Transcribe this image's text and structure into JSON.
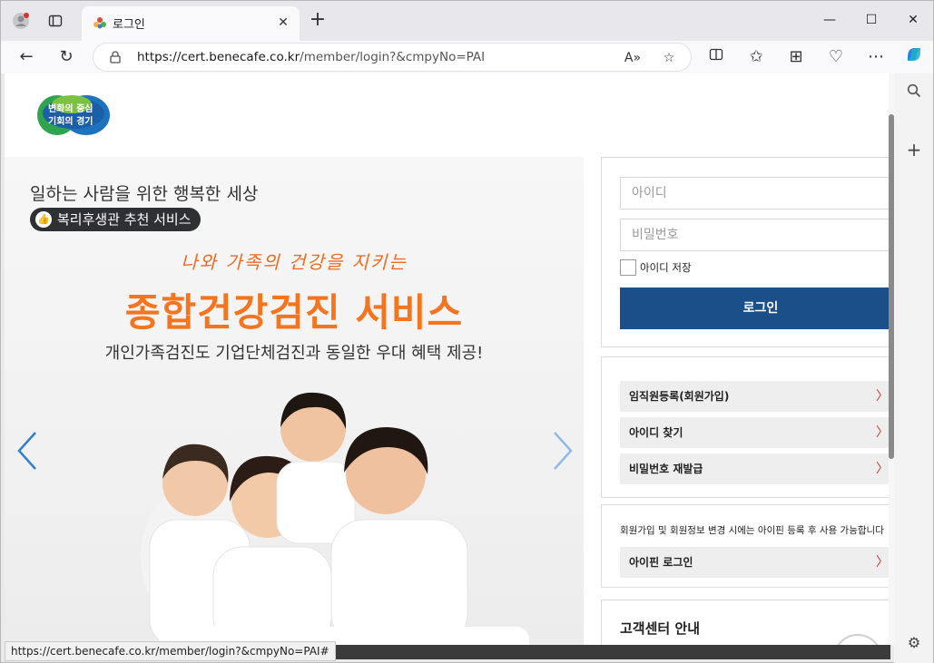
{
  "browser": {
    "tab_title": "로그인",
    "url_host": "https://cert.benecafe.co.kr",
    "url_path": "/member/login?&cmpyNo=PAI",
    "status_url": "https://cert.benecafe.co.kr/member/login?&cmpyNo=PAI#"
  },
  "logo": {
    "line1": "변화의 중심",
    "line2": "기회의 경기"
  },
  "banner": {
    "line1": "일하는 사람을 위한 행복한 세상",
    "badge": "복리후생관 추천 서비스",
    "script": "나와 가족의 건강을 지키는",
    "headline": "종합건강검진 서비스",
    "sub": "개인가족검진도 기업단체검진과 동일한 우대 혜택 제공!"
  },
  "login": {
    "id_placeholder": "아이디",
    "pw_placeholder": "비밀번호",
    "remember_label": "아이디 저장",
    "login_button": "로그인"
  },
  "links": [
    {
      "label": "임직원등록(회원가입)"
    },
    {
      "label": "아이디 찾기"
    },
    {
      "label": "비밀번호 재발급"
    }
  ],
  "ipin": {
    "note": "회원가입 및 회원정보 변경 시에는 아이핀 등록 후 사용 가능합니다",
    "button": "아이핀 로그인"
  },
  "customer_center": {
    "title": "고객센터 안내"
  },
  "colors": {
    "accent_orange": "#f5751f",
    "login_blue": "#1b4f8a",
    "chevron_red": "#d0302f"
  }
}
